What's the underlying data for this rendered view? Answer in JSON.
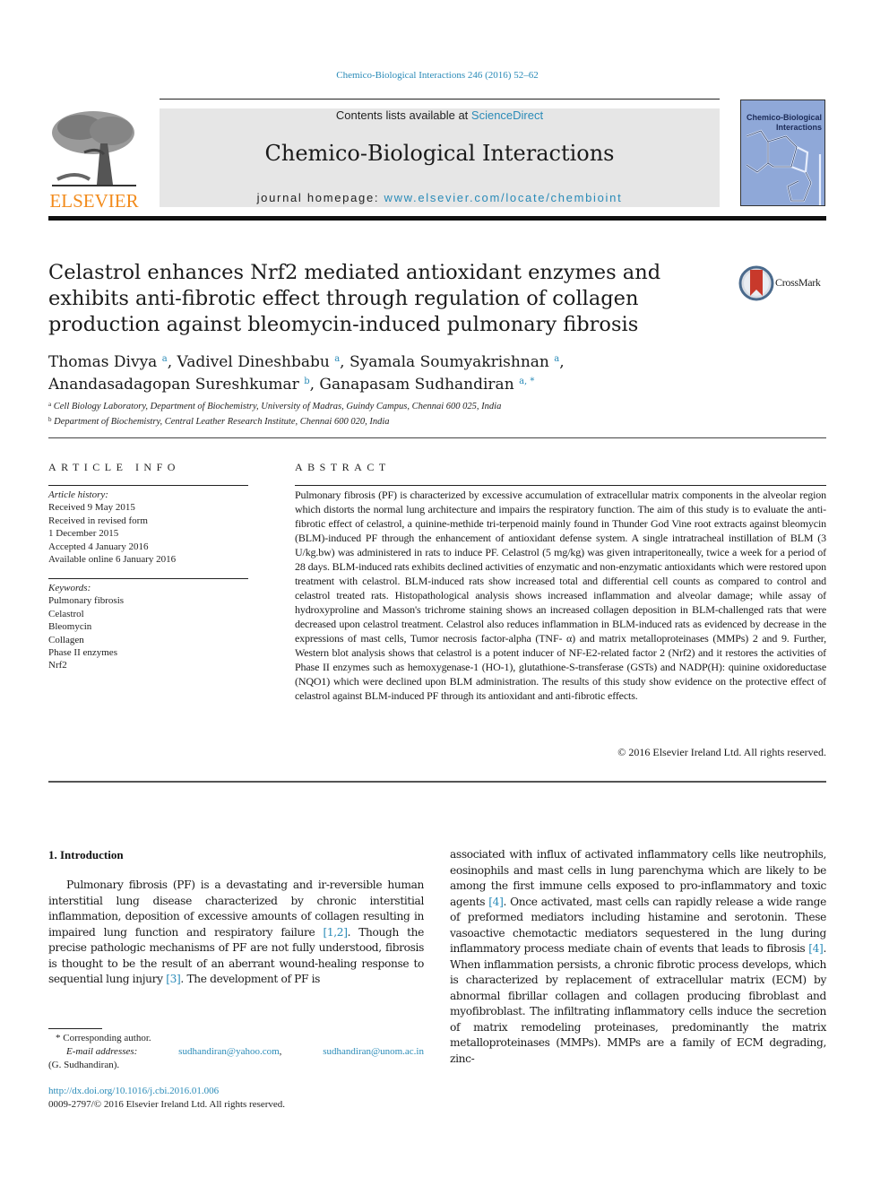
{
  "citation": "Chemico-Biological Interactions 246 (2016) 52–62",
  "header": {
    "publisher": "ELSEVIER",
    "contents_prefix": "Contents lists available at ",
    "contents_link": "ScienceDirect",
    "journal_title": "Chemico-Biological Interactions",
    "homepage_prefix": "journal homepage: ",
    "homepage_link": "www.elsevier.com/locate/chembioint",
    "cover_title_1": "Chemico-Biological",
    "cover_title_2": "Interactions",
    "colors": {
      "publisher_orange": "#f28b1c",
      "link_blue": "#2a8bb8",
      "header_gray": "#e6e6e6",
      "cover_blue": "#8fa8d8"
    }
  },
  "article": {
    "title": "Celastrol enhances Nrf2 mediated antioxidant enzymes and exhibits anti-fibrotic effect through regulation of collagen production against bleomycin-induced pulmonary fibrosis",
    "crossmark_label": "CrossMark",
    "authors": [
      {
        "name": "Thomas Divya",
        "affil": "a",
        "sep": ", "
      },
      {
        "name": "Vadivel Dineshbabu",
        "affil": "a",
        "sep": ", "
      },
      {
        "name": "Syamala Soumyakrishnan",
        "affil": "a",
        "sep": ","
      },
      {
        "name": "Anandasadagopan Sureshkumar",
        "affil": "b",
        "sep": ", "
      },
      {
        "name": "Ganapasam Sudhandiran",
        "affil": "a, *",
        "sep": ""
      }
    ],
    "affiliations": [
      {
        "key": "a",
        "text": "Cell Biology Laboratory, Department of Biochemistry, University of Madras, Guindy Campus, Chennai 600 025, India"
      },
      {
        "key": "b",
        "text": "Department of Biochemistry, Central Leather Research Institute, Chennai 600 020, India"
      }
    ]
  },
  "article_info": {
    "heading": "ARTICLE INFO",
    "history_label": "Article history:",
    "history": [
      "Received 9 May 2015",
      "Received in revised form",
      "1 December 2015",
      "Accepted 4 January 2016",
      "Available online 6 January 2016"
    ],
    "keywords_label": "Keywords:",
    "keywords": [
      "Pulmonary fibrosis",
      "Celastrol",
      "Bleomycin",
      "Collagen",
      "Phase II enzymes",
      "Nrf2"
    ]
  },
  "abstract": {
    "heading": "ABSTRACT",
    "text": "Pulmonary fibrosis (PF) is characterized by excessive accumulation of extracellular matrix components in the alveolar region which distorts the normal lung architecture and impairs the respiratory function. The aim of this study is to evaluate the anti-fibrotic effect of celastrol, a quinine-methide tri-terpenoid mainly found in Thunder God Vine root extracts against bleomycin (BLM)-induced PF through the enhancement of antioxidant defense system. A single intratracheal instillation of BLM (3 U/kg.bw) was administered in rats to induce PF. Celastrol (5 mg/kg) was given intraperitoneally, twice a week for a period of 28 days. BLM-induced rats exhibits declined activities of enzymatic and non-enzymatic antioxidants which were restored upon treatment with celastrol. BLM-induced rats show increased total and differential cell counts as compared to control and celastrol treated rats. Histopathological analysis shows increased inflammation and alveolar damage; while assay of hydroxyproline and Masson's trichrome staining shows an increased collagen deposition in BLM-challenged rats that were decreased upon celastrol treatment. Celastrol also reduces inflammation in BLM-induced rats as evidenced by decrease in the expressions of mast cells, Tumor necrosis factor-alpha (TNF- α) and matrix metalloproteinases (MMPs) 2 and 9. Further, Western blot analysis shows that celastrol is a potent inducer of NF-E2-related factor 2 (Nrf2) and it restores the activities of Phase II enzymes such as hemoxygenase-1 (HO-1), glutathione-S-transferase (GSTs) and NADP(H): quinine oxidoreductase (NQO1) which were declined upon BLM administration. The results of this study show evidence on the protective effect of celastrol against BLM-induced PF through its antioxidant and anti-fibrotic effects.",
    "copyright": "© 2016 Elsevier Ireland Ltd. All rights reserved."
  },
  "introduction": {
    "heading": "1.  Introduction",
    "left_segments": [
      {
        "t": "Pulmonary fibrosis (PF) is a devastating and ir-reversible human interstitial lung disease characterized by chronic interstitial inflammation, deposition of excessive amounts of collagen resulting in impaired lung function and respiratory failure "
      },
      {
        "ref": "[1,2]"
      },
      {
        "t": ". Though the precise pathologic mechanisms of PF are not fully understood, fibrosis is thought to be the result of an aberrant wound-healing response to sequential lung injury "
      },
      {
        "ref": "[3]"
      },
      {
        "t": ". The development of PF is"
      }
    ],
    "right_segments": [
      {
        "t": "associated with influx of activated inflammatory cells like neutrophils, eosinophils and mast cells in lung parenchyma which are likely to be among the first immune cells exposed to pro-inflammatory and toxic agents "
      },
      {
        "ref": "[4]"
      },
      {
        "t": ". Once activated, mast cells can rapidly release a wide range of preformed mediators including histamine and serotonin. These vasoactive chemotactic mediators sequestered in the lung during inflammatory process mediate chain of events that leads to fibrosis "
      },
      {
        "ref": "[4]"
      },
      {
        "t": ". When inflammation persists, a chronic fibrotic process develops, which is characterized by replacement of extracellular matrix (ECM) by abnormal fibrillar collagen and collagen producing fibroblast and myofibroblast. The infiltrating inflammatory cells induce the secretion of matrix remodeling proteinases, predominantly the matrix metalloproteinases (MMPs). MMPs are a family of ECM degrading, zinc-"
      }
    ]
  },
  "footnotes": {
    "corresponding": "* Corresponding author.",
    "email_label": "E-mail addresses:",
    "emails": [
      "sudhandiran@yahoo.com",
      "sudhandiran@unom.ac.in"
    ],
    "email_owner": "(G. Sudhandiran).",
    "doi": "http://dx.doi.org/10.1016/j.cbi.2016.01.006",
    "issn_copyright": "0009-2797/© 2016 Elsevier Ireland Ltd. All rights reserved."
  }
}
